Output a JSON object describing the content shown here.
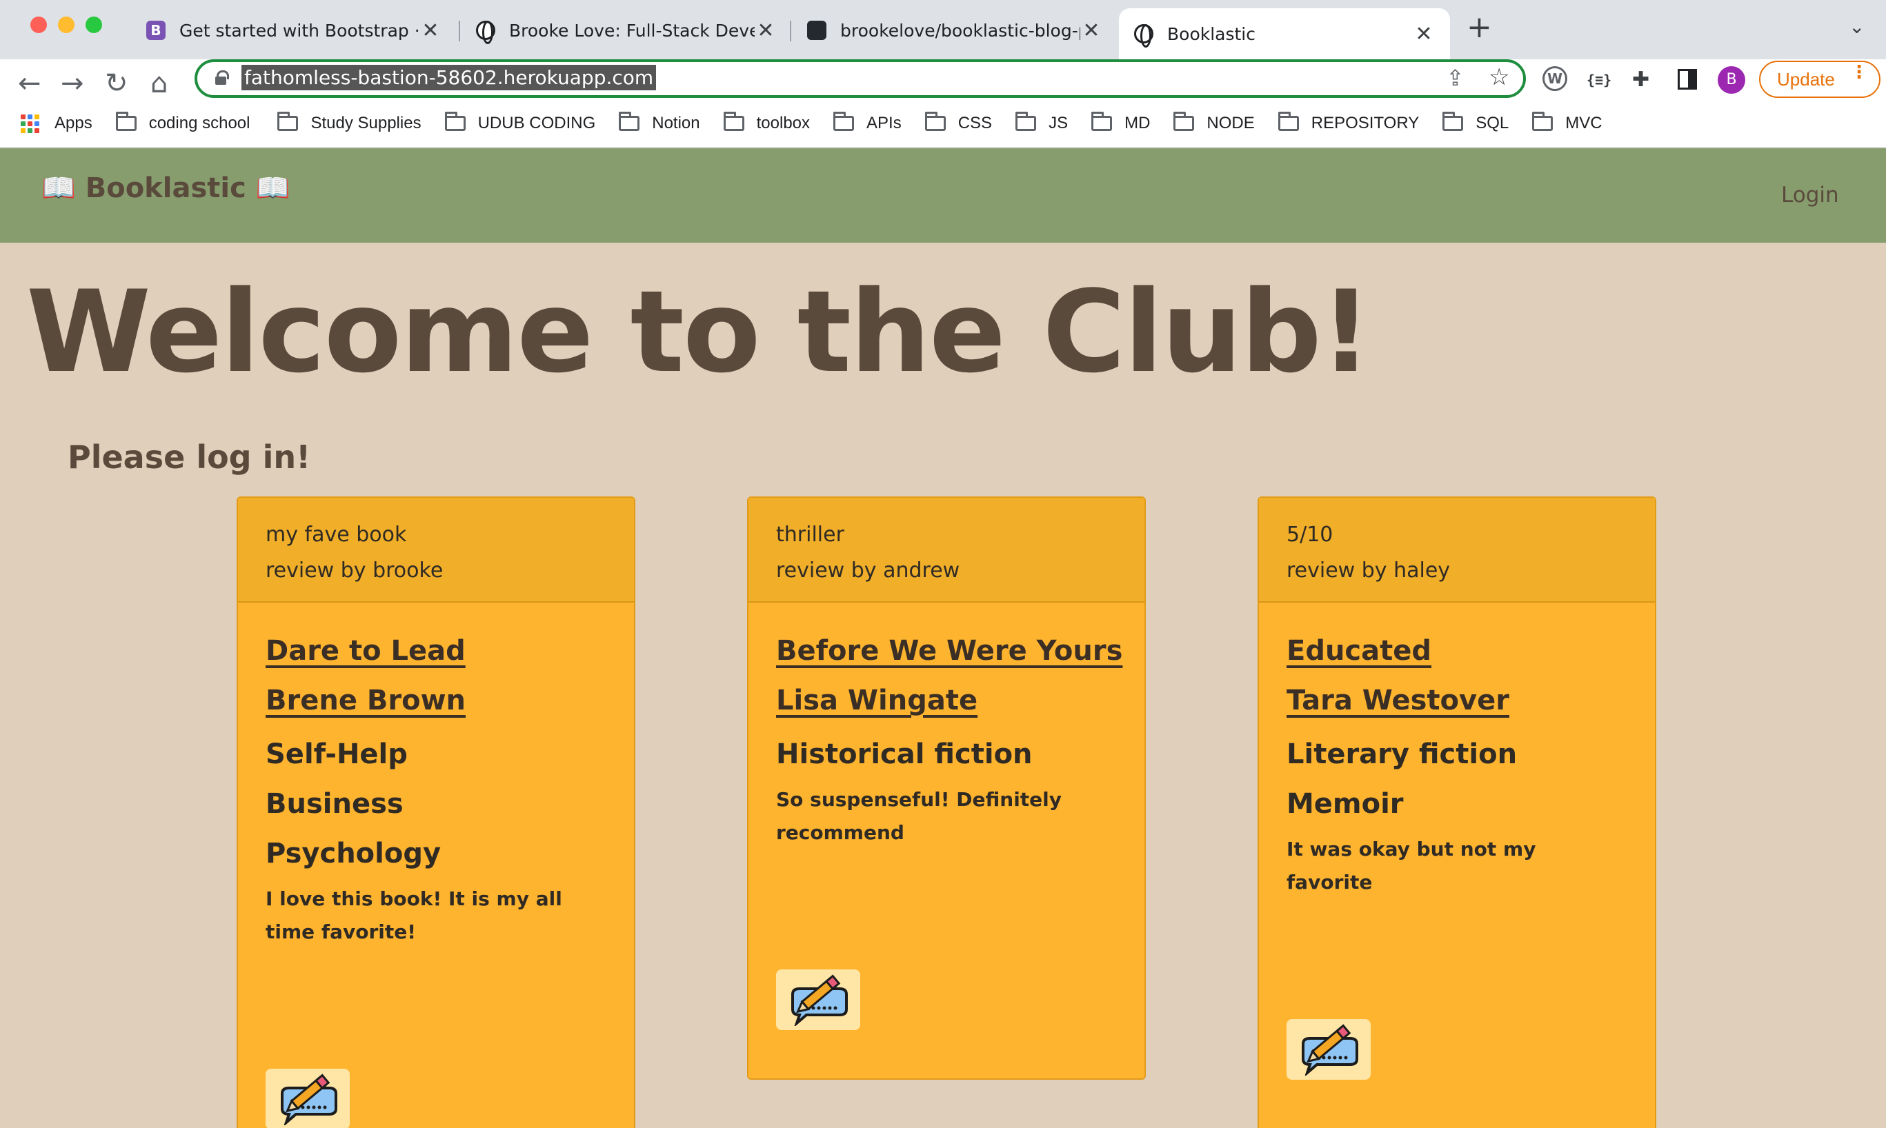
{
  "browser": {
    "tabs": [
      {
        "title": "Get started with Bootstrap · Bo",
        "favicon": "bootstrap-icon",
        "active": false
      },
      {
        "title": "Brooke Love: Full-Stack Develo",
        "favicon": "globe-icon",
        "active": false
      },
      {
        "title": "brookelove/booklastic-blog-pla",
        "favicon": "github-icon",
        "active": false
      },
      {
        "title": "Booklastic",
        "favicon": "globe-icon",
        "active": true
      }
    ],
    "url": "fathomless-bastion-58602.herokuapp.com",
    "profile_initial": "B",
    "update_label": "Update",
    "bookmarks": [
      "Apps",
      "coding school",
      "Study Supplies",
      "UDUB CODING",
      "Notion",
      "toolbox",
      "APIs",
      "CSS",
      "JS",
      "MD",
      "NODE",
      "REPOSITORY",
      "SQL",
      "MVC"
    ]
  },
  "site": {
    "brand": "📖 Booklastic 📖",
    "login_label": "Login",
    "welcome": "Welcome to the Club!",
    "please_login": "Please log in!"
  },
  "posts": [
    {
      "title": "my fave book",
      "byline": "review by brooke",
      "book": "Dare to Lead",
      "author": "Brene Brown",
      "genres": [
        "Self-Help",
        "Business",
        "Psychology"
      ],
      "review": "I love this book! It is my all time favorite!"
    },
    {
      "title": "thriller",
      "byline": "review by andrew",
      "book": "Before We Were Yours",
      "author": "Lisa Wingate",
      "genres": [
        "Historical fiction"
      ],
      "review": "So suspenseful! Definitely recommend"
    },
    {
      "title": "5/10",
      "byline": "review by haley",
      "book": "Educated",
      "author": "Tara Westover",
      "genres": [
        "Literary fiction",
        "Memoir"
      ],
      "review": "It was okay but not my favorite"
    }
  ],
  "colors": {
    "navbar": "#879d6e",
    "page_bg": "#e0cfba",
    "card": "#ffb42f",
    "card_header": "#f0ae29",
    "text": "#5a4a3c"
  }
}
